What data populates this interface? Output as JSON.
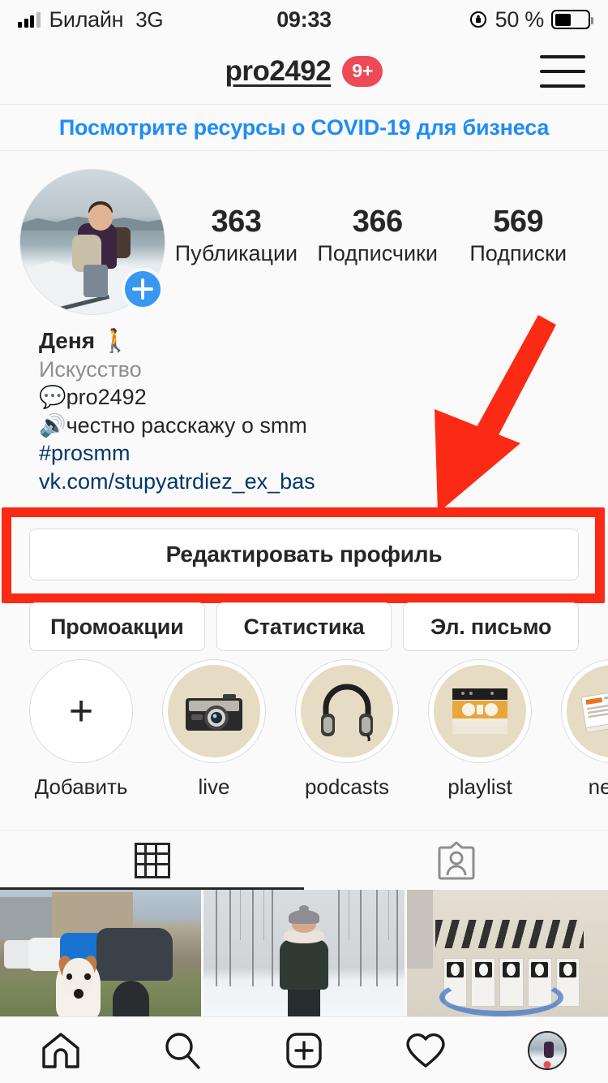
{
  "status_bar": {
    "carrier": "Билайн",
    "network": "3G",
    "time": "09:33",
    "battery_percent": "50 %",
    "battery_level": 50,
    "signal_icon": "signal-bars-icon",
    "rotation_lock_icon": "rotation-lock-icon",
    "battery_icon": "battery-icon"
  },
  "header": {
    "username": "pro2492",
    "badge": "9+",
    "badge_color": "#ED4956",
    "menu_icon": "hamburger-menu-icon"
  },
  "covid_banner": {
    "text": "Посмотрите ресурсы о COVID-19 для бизнеса",
    "color": "#1F8DF5"
  },
  "profile": {
    "avatar_name": "profile-avatar",
    "add_story_icon": "plus-icon",
    "stats": [
      {
        "value": "363",
        "label": "Публикации"
      },
      {
        "value": "366",
        "label": "Подписчики"
      },
      {
        "value": "569",
        "label": "Подписки"
      }
    ],
    "bio": {
      "display_name": "Деня 🚶",
      "category": "Искусство",
      "line1": "💬pro2492",
      "line2": "🔊честно расскажу о smm",
      "hashtag": "#prosmm",
      "url": "vk.com/stupyatrdiez_ex_bas"
    }
  },
  "actions": {
    "edit_profile": "Редактировать профиль",
    "promotions": "Промоакции",
    "insights": "Статистика",
    "email": "Эл. письмо"
  },
  "annotation": {
    "highlight_color": "#FA2A14",
    "arrow_icon": "red-arrow-icon",
    "box_icon": "red-highlight-box"
  },
  "highlights": [
    {
      "label": "Добавить",
      "icon": "plus-icon",
      "type": "add"
    },
    {
      "label": "live",
      "icon": "camera-icon",
      "type": "story"
    },
    {
      "label": "podcasts",
      "icon": "headphones-icon",
      "type": "story"
    },
    {
      "label": "playlist",
      "icon": "cassette-icon",
      "type": "story"
    },
    {
      "label": "news",
      "icon": "newspaper-icon",
      "type": "story"
    }
  ],
  "tabs": [
    {
      "name": "grid",
      "icon": "grid-icon",
      "active": true
    },
    {
      "name": "tagged",
      "icon": "tagged-person-icon",
      "active": false
    }
  ],
  "photo_grid": [
    {
      "name": "photo-dog-and-cars"
    },
    {
      "name": "photo-person-winter-forest"
    },
    {
      "name": "photo-graffiti-wall"
    }
  ],
  "bottom_nav": [
    {
      "name": "home",
      "icon": "home-icon"
    },
    {
      "name": "search",
      "icon": "search-icon"
    },
    {
      "name": "create",
      "icon": "plus-square-icon"
    },
    {
      "name": "activity",
      "icon": "heart-icon"
    },
    {
      "name": "profile",
      "icon": "profile-avatar-icon"
    }
  ]
}
